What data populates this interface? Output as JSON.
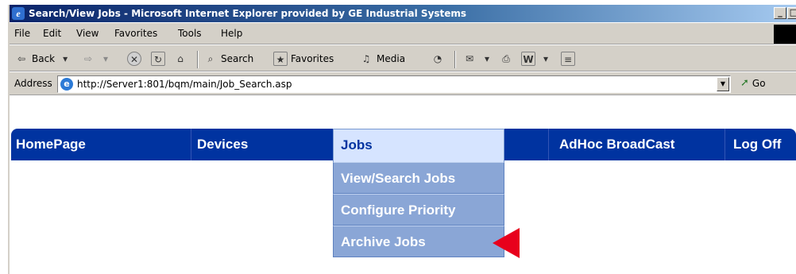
{
  "window": {
    "title": "Search/View Jobs - Microsoft Internet Explorer provided by GE Industrial Systems",
    "min_label": "_",
    "max_label": "□"
  },
  "menubar": {
    "items": [
      "File",
      "Edit",
      "View",
      "Favorites",
      "Tools",
      "Help"
    ]
  },
  "toolbar": {
    "back_label": "Back",
    "search_label": "Search",
    "favorites_label": "Favorites",
    "media_label": "Media",
    "icons": [
      "back-arrow",
      "forward-arrow",
      "stop",
      "refresh",
      "home",
      "search",
      "favorites",
      "media",
      "history",
      "mail",
      "print",
      "edit-word",
      "discuss"
    ]
  },
  "addressbar": {
    "label": "Address",
    "url": "http://Server1:801/bqm/main/Job_Search.asp",
    "go_label": "Go"
  },
  "nav": {
    "items": [
      {
        "label": "HomePage"
      },
      {
        "label": "Devices"
      },
      {
        "label": "Jobs"
      },
      {
        "label": "AdHoc BroadCast"
      },
      {
        "label": "Log Off"
      }
    ],
    "active": "Jobs"
  },
  "dropdown": {
    "items": [
      "View/Search Jobs",
      "Configure Priority",
      "Archive Jobs"
    ]
  },
  "colors": {
    "nav_bg": "#0033a0",
    "dropdown_bg": "#8aa6d6",
    "pointer": "#e8001c"
  }
}
